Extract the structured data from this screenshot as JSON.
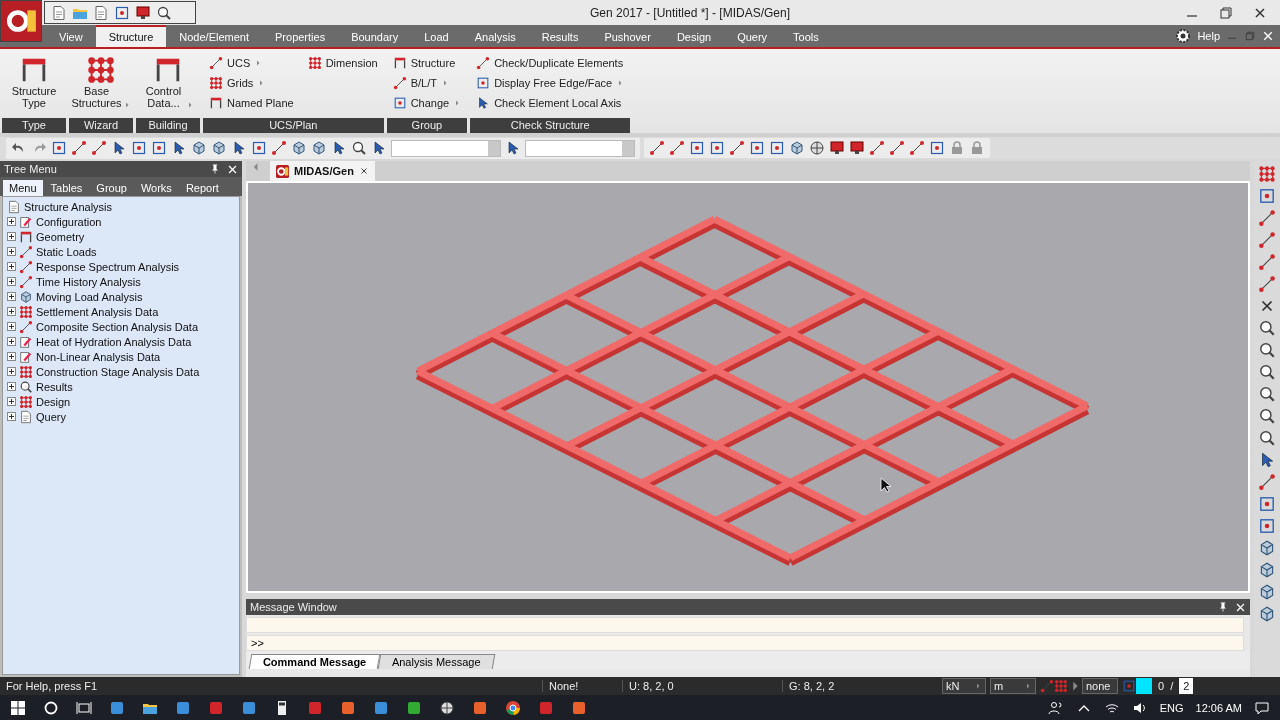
{
  "window": {
    "title": "Gen 2017 - [Untitled *] - [MIDAS/Gen]"
  },
  "menu_tabs": [
    {
      "label": "View",
      "selected": false
    },
    {
      "label": "Structure",
      "selected": true
    },
    {
      "label": "Node/Element",
      "selected": false
    },
    {
      "label": "Properties",
      "selected": false
    },
    {
      "label": "Boundary",
      "selected": false
    },
    {
      "label": "Load",
      "selected": false
    },
    {
      "label": "Analysis",
      "selected": false
    },
    {
      "label": "Results",
      "selected": false
    },
    {
      "label": "Pushover",
      "selected": false
    },
    {
      "label": "Design",
      "selected": false
    },
    {
      "label": "Query",
      "selected": false
    },
    {
      "label": "Tools",
      "selected": false
    }
  ],
  "help": "Help",
  "ribbon_groups": [
    {
      "label": "Type",
      "items": [
        {
          "kind": "large",
          "label": "Structure Type",
          "dropdown": false
        }
      ]
    },
    {
      "label": "Wizard",
      "items": [
        {
          "kind": "large",
          "label": "Base Structures",
          "dropdown": true
        }
      ]
    },
    {
      "label": "Building",
      "items": [
        {
          "kind": "large",
          "label": "Control Data...",
          "dropdown": true
        }
      ]
    },
    {
      "label": "UCS/Plan",
      "items": [
        {
          "kind": "small",
          "label": "UCS",
          "dropdown": true
        },
        {
          "kind": "small",
          "label": "Grids",
          "dropdown": true
        },
        {
          "kind": "small",
          "label": "Named Plane",
          "dropdown": false
        },
        {
          "kind": "small",
          "label": "Dimension",
          "dropdown": false
        }
      ]
    },
    {
      "label": "Group",
      "items": [
        {
          "kind": "small",
          "label": "Structure",
          "dropdown": false
        },
        {
          "kind": "small",
          "label": "B/L/T",
          "dropdown": true
        },
        {
          "kind": "small",
          "label": "Change",
          "dropdown": true
        }
      ]
    },
    {
      "label": "Check Structure",
      "items": [
        {
          "kind": "small",
          "label": "Check/Duplicate Elements",
          "dropdown": false
        },
        {
          "kind": "small",
          "label": "Display Free Edge/Face",
          "dropdown": true
        },
        {
          "kind": "small",
          "label": "Check Element Local Axis",
          "dropdown": false
        }
      ]
    }
  ],
  "tree_menu": {
    "title": "Tree Menu",
    "tabs": [
      {
        "label": "Menu",
        "selected": true
      },
      {
        "label": "Tables",
        "selected": false
      },
      {
        "label": "Group",
        "selected": false
      },
      {
        "label": "Works",
        "selected": false
      },
      {
        "label": "Report",
        "selected": false
      }
    ],
    "root": "Structure Analysis",
    "items": [
      {
        "label": "Configuration",
        "expanded": false
      },
      {
        "label": "Geometry",
        "expanded": false
      },
      {
        "label": "Static Loads",
        "expanded": false
      },
      {
        "label": "Response Spectrum Analysis",
        "expanded": false
      },
      {
        "label": "Time History Analysis",
        "expanded": false
      },
      {
        "label": "Moving Load Analysis",
        "expanded": false
      },
      {
        "label": "Settlement Analysis Data",
        "expanded": false
      },
      {
        "label": "Composite Section Analysis Data",
        "expanded": false
      },
      {
        "label": "Heat of Hydration Analysis Data",
        "expanded": false
      },
      {
        "label": "Non-Linear Analysis Data",
        "expanded": false
      },
      {
        "label": "Construction Stage Analysis Data",
        "expanded": false
      },
      {
        "label": "Results",
        "expanded": false
      },
      {
        "label": "Design",
        "expanded": false
      },
      {
        "label": "Query",
        "expanded": false
      }
    ]
  },
  "document_tab": {
    "label": "MIDAS/Gen"
  },
  "message_window": {
    "title": "Message Window",
    "prompt": ">>",
    "tabs": [
      {
        "label": "Command Message",
        "selected": true
      },
      {
        "label": "Analysis Message",
        "selected": false
      }
    ]
  },
  "status_bar": {
    "help": "For Help, press F1",
    "cells": [
      "None!",
      "U: 8, 2, 0",
      "G: 8, 2, 2"
    ],
    "force_unit": "kN",
    "length_unit": "m",
    "mode": "none",
    "page_value": "0",
    "separator": "/",
    "page_total": "2"
  },
  "taskbar": {
    "language": "ENG",
    "time": "12:06 AM"
  }
}
